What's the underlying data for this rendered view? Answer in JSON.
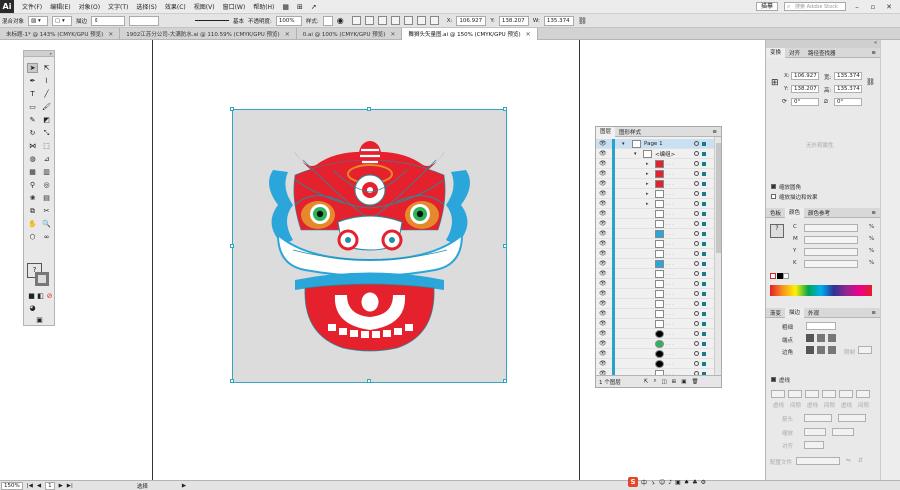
{
  "app": {
    "logo": "Ai"
  },
  "menu": [
    "文件(F)",
    "编辑(E)",
    "对象(O)",
    "文字(T)",
    "选择(S)",
    "效果(C)",
    "视图(V)",
    "窗口(W)",
    "帮助(H)"
  ],
  "workspace_mode": "描摹",
  "search_placeholder": "搜索 Adobe Stock",
  "control_bar": {
    "selection_label": "混合对象",
    "stroke_label": "描边",
    "stroke_style": "基本",
    "opacity_label": "不透明度:",
    "opacity_value": "100%",
    "style_label": "样式:",
    "x": "106.927",
    "y": "138.207",
    "w": "135.374"
  },
  "tabs": [
    {
      "label": "未标题-1* @ 143% (CMYK/GPU 预览)",
      "active": false
    },
    {
      "label": "1902江苏分公司-大满防水.ai @ 110.59% (CMYK/GPU 预览)",
      "active": false
    },
    {
      "label": "0.ai @ 100% (CMYK/GPU 预览)",
      "active": false
    },
    {
      "label": "舞狮头矢量图.ai @ 150% (CMYK/GPU 预览)",
      "active": true
    }
  ],
  "layers_panel": {
    "tabs": [
      "图层",
      "图形样式"
    ],
    "top_layer": "Page 1",
    "group_label": "<编组>",
    "footer": "1 个图层",
    "row_count": 22
  },
  "transform_panel": {
    "tabs": [
      "变换",
      "对齐",
      "路径查找器"
    ],
    "x": "106.927",
    "y": "138.207",
    "w": "135.374",
    "h": "135.374",
    "angle": "0°",
    "shear": "0°",
    "no_appearance": "无外观属性",
    "scale_corners": "缩放圆角",
    "scale_strokes": "缩放描边和效果"
  },
  "color_panel": {
    "tabs": [
      "色板",
      "颜色",
      "颜色参考"
    ],
    "channels": [
      "C",
      "M",
      "Y",
      "K"
    ],
    "unit": "%"
  },
  "stroke_panel": {
    "tabs": [
      "渐变",
      "描边",
      "外观"
    ],
    "weight_label": "粗细",
    "cap_label": "端点",
    "corner_label": "边角",
    "limit_label": "限制",
    "stroke_row": "虚线",
    "dash_labels": [
      "虚线",
      "间隙",
      "虚线",
      "间隙",
      "虚线",
      "间隙"
    ],
    "arrow_label": "箭头",
    "scale_label": "缩放",
    "align_label": "对齐",
    "profile_label": "配置文件"
  },
  "status_bar": {
    "zoom": "150%",
    "page": "1",
    "tool": "选择"
  },
  "ime": {
    "logo": "S",
    "labels": [
      "中",
      "ゝ",
      "☺",
      "♪",
      "▣",
      "♠",
      "♣",
      "⚙"
    ]
  },
  "colors": {
    "lion_red": "#e4212d",
    "lion_blue": "#2aa6da",
    "lion_teal": "#1f8fa4",
    "lion_orange": "#e58a2c",
    "lion_green": "#2bb55b",
    "artboard_bg": "#dcdcdc",
    "selection": "#33a6c2"
  }
}
